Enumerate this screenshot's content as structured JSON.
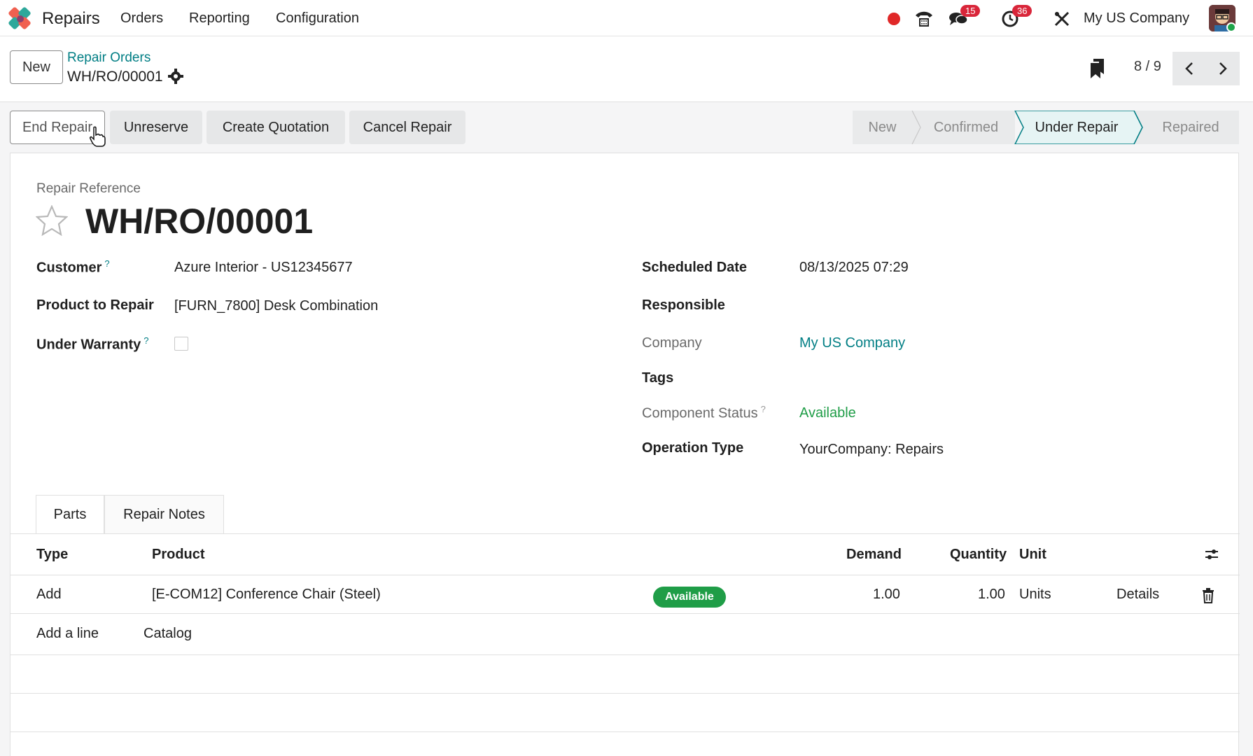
{
  "navbar": {
    "app_name": "Repairs",
    "menu": [
      "Orders",
      "Reporting",
      "Configuration"
    ],
    "messages_count": "15",
    "activities_count": "36",
    "company": "My US Company"
  },
  "control": {
    "new_label": "New",
    "breadcrumb_parent": "Repair Orders",
    "breadcrumb_current": "WH/RO/00001",
    "pager": "8 / 9"
  },
  "actions": {
    "end_repair": "End Repair",
    "unreserve": "Unreserve",
    "create_quotation": "Create Quotation",
    "cancel_repair": "Cancel Repair"
  },
  "stages": [
    "New",
    "Confirmed",
    "Under Repair",
    "Repaired"
  ],
  "active_stage": "Under Repair",
  "form": {
    "ref_label": "Repair Reference",
    "ref_value": "WH/RO/00001",
    "customer_label": "Customer",
    "customer_value": "Azure Interior - US12345677",
    "product_label": "Product to Repair",
    "product_value": "[FURN_7800] Desk Combination",
    "warranty_label": "Under Warranty",
    "scheduled_label": "Scheduled Date",
    "scheduled_value": "08/13/2025 07:29",
    "responsible_label": "Responsible",
    "company_label": "Company",
    "company_value": "My US Company",
    "tags_label": "Tags",
    "component_status_label": "Component Status",
    "component_status_value": "Available",
    "operation_type_label": "Operation Type",
    "operation_type_value": "YourCompany: Repairs",
    "help_mark": "?"
  },
  "tabs": [
    "Parts",
    "Repair Notes"
  ],
  "parts_table": {
    "headers": {
      "type": "Type",
      "product": "Product",
      "demand": "Demand",
      "quantity": "Quantity",
      "unit": "Unit"
    },
    "rows": [
      {
        "type": "Add",
        "product": "[E-COM12] Conference Chair (Steel)",
        "status": "Available",
        "demand": "1.00",
        "quantity": "1.00",
        "unit": "Units",
        "details": "Details"
      }
    ],
    "add_line": "Add a line",
    "catalog": "Catalog"
  },
  "colors": {
    "accent": "#017e84",
    "brand_badge": "#d9263a",
    "available": "#1f9d47"
  }
}
